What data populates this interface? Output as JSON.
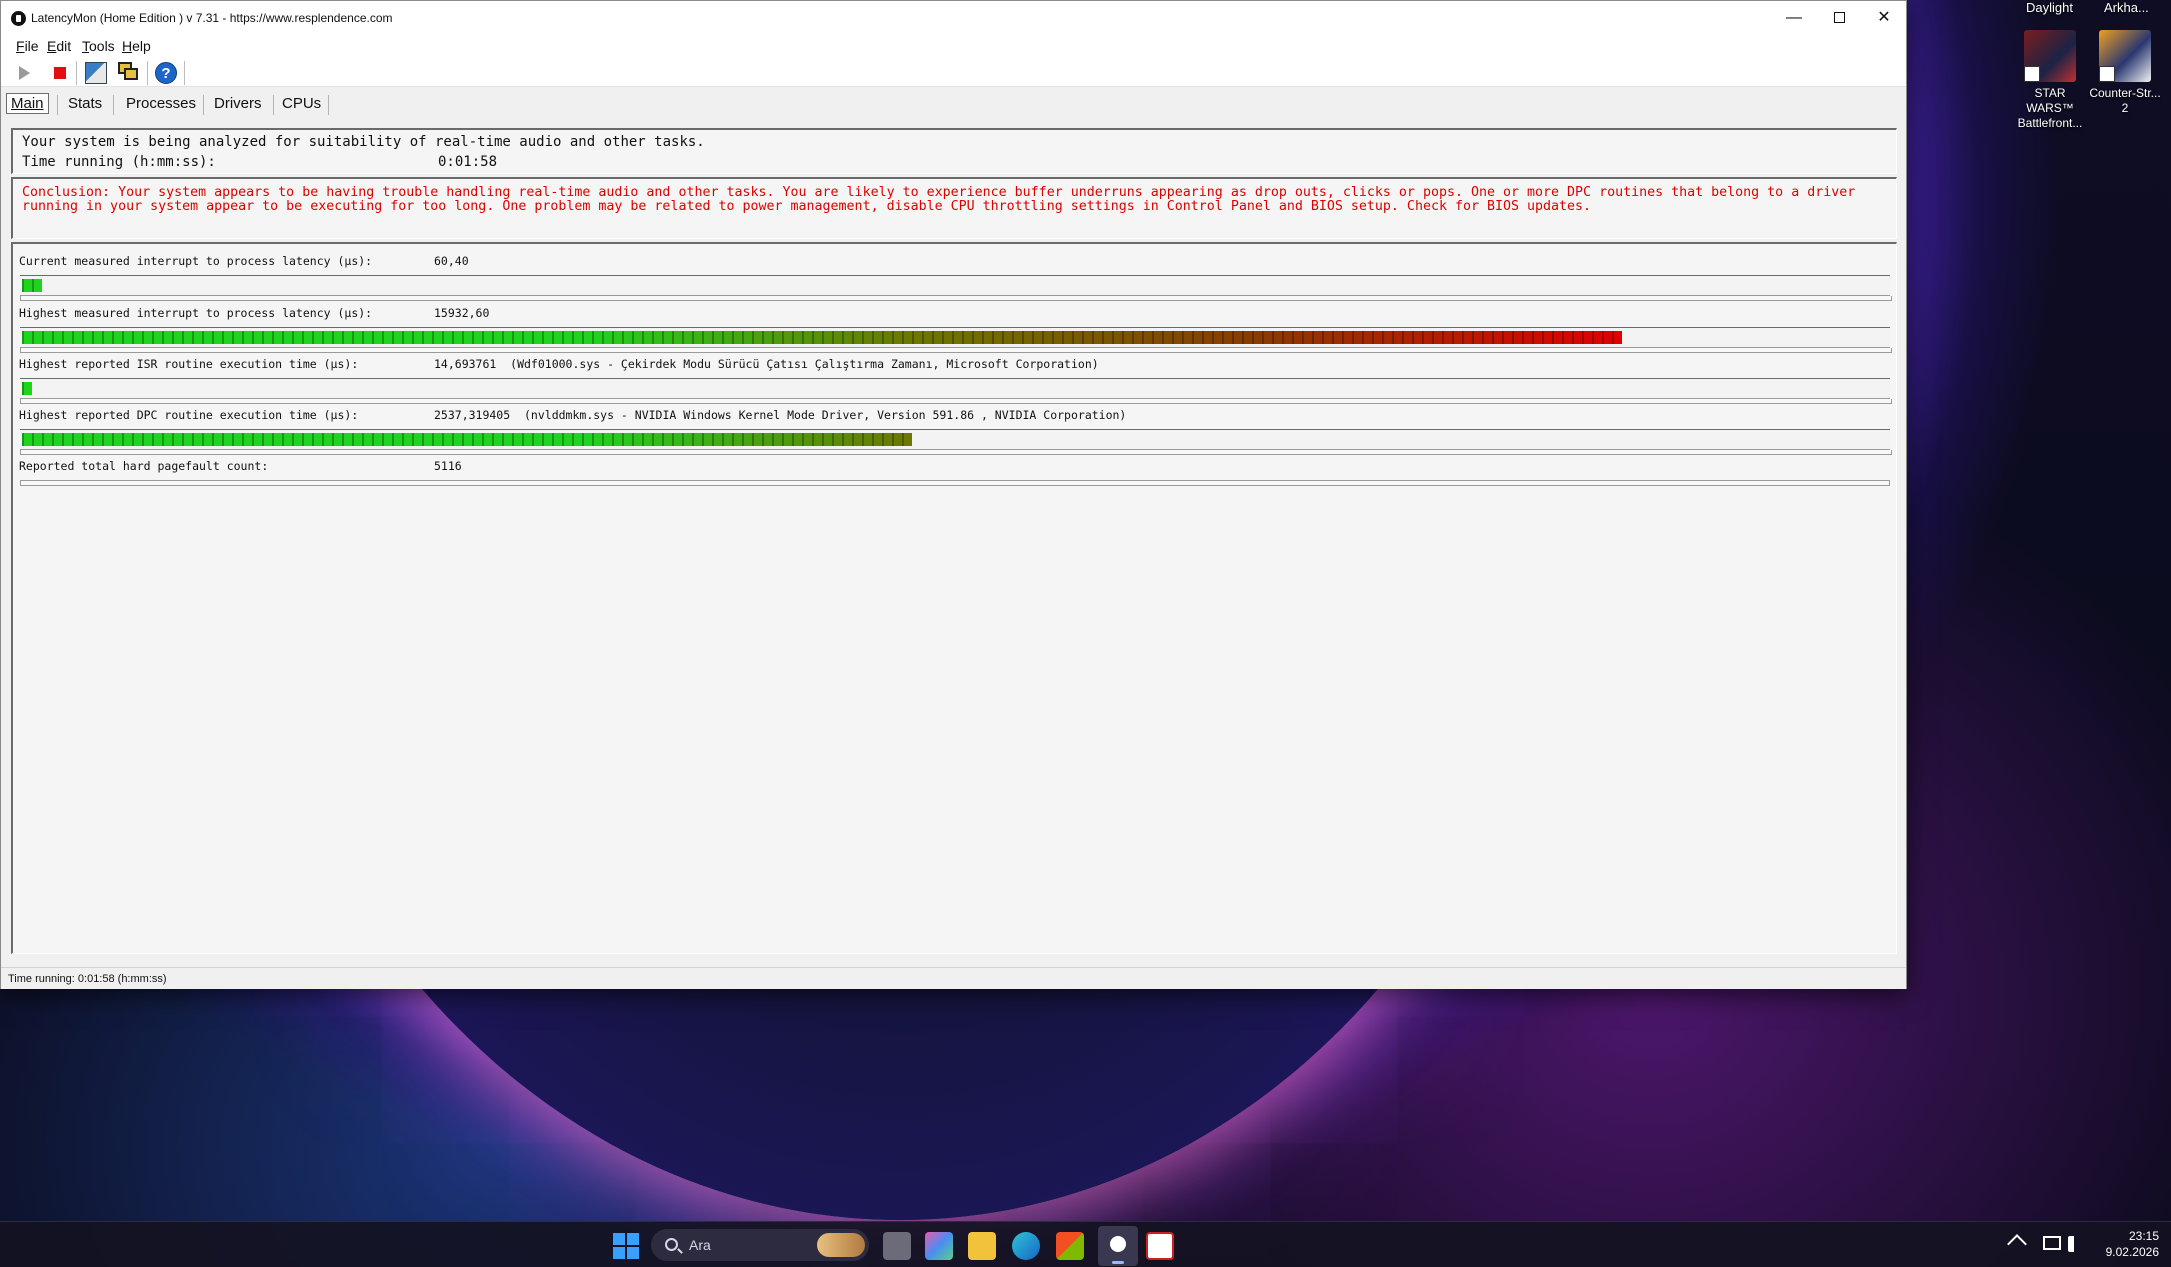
{
  "desktop": {
    "top_labels": [
      "Daylight",
      "Arkha..."
    ],
    "icons": [
      {
        "label": "STAR WARS™ Battlefront...",
        "icon": "star-wars-battlefront-icon"
      },
      {
        "label": "Counter-Str... 2",
        "icon": "counter-strike-2-icon"
      }
    ]
  },
  "window": {
    "title": "LatencyMon  (Home Edition )  v 7.31 - https://www.resplendence.com",
    "controls": {
      "minimize": "—",
      "close": "✕"
    }
  },
  "menu": [
    {
      "label": "File",
      "key": "F",
      "rest": "ile"
    },
    {
      "label": "Edit",
      "key": "E",
      "rest": "dit"
    },
    {
      "label": "Tools",
      "key": "T",
      "rest": "ools"
    },
    {
      "label": "Help",
      "key": "H",
      "rest": "elp"
    }
  ],
  "toolbar": {
    "play": "play-icon",
    "stop": "stop-icon",
    "properties": "properties-icon",
    "windows": "windows-icon",
    "help": "?"
  },
  "tabs": [
    {
      "label": "Main",
      "active": true
    },
    {
      "label": "Stats",
      "active": false
    },
    {
      "label": "Processes",
      "active": false
    },
    {
      "label": "Drivers",
      "active": false
    },
    {
      "label": "CPUs",
      "active": false
    }
  ],
  "summary": {
    "analyzing": "Your system is being analyzed for suitability of real-time audio and other tasks.",
    "time_label": "Time running (h:mm:ss):",
    "time_value": "0:01:58"
  },
  "conclusion": "Conclusion: Your system appears to be having trouble handling real-time audio and other tasks. You are likely to experience buffer underruns appearing as drop outs, clicks or pops. One or more DPC routines that belong to a driver running in your system appear to be executing for too long. One problem may be related to power management, disable CPU throttling settings in Control Panel and BIOS setup. Check for BIOS updates.",
  "metrics": [
    {
      "label": "Current measured interrupt to process latency (µs):",
      "value": "60,40",
      "level": 0.013
    },
    {
      "label": "Highest measured interrupt to process latency (µs):",
      "value": "15932,60",
      "level": 0.86
    },
    {
      "label": "Highest reported ISR routine execution time (µs):",
      "value": "14,693761  (Wdf01000.sys - Çekirdek Modu Sürücü Çatısı Çalıştırma Zamanı, Microsoft Corporation)",
      "level": 0.005
    },
    {
      "label": "Highest reported DPC routine execution time (µs):",
      "value": "2537,319405  (nvlddmkm.sys - NVIDIA Windows Kernel Mode Driver, Version 591.86 , NVIDIA Corporation)",
      "level": 0.48
    },
    {
      "label": "Reported total hard pagefault count:",
      "value": "5116"
    }
  ],
  "statusbar": "Time running: 0:01:58  (h:mm:ss)",
  "taskbar": {
    "search_placeholder": "Ara",
    "time": "23:15",
    "date": "9.02.2026"
  },
  "colors": {
    "bar_green": "#1fd41f",
    "bar_olive": "#6b7a00",
    "bar_brown": "#8a3a00",
    "bar_red": "#e00000",
    "conclusion_text": "#e00000"
  }
}
